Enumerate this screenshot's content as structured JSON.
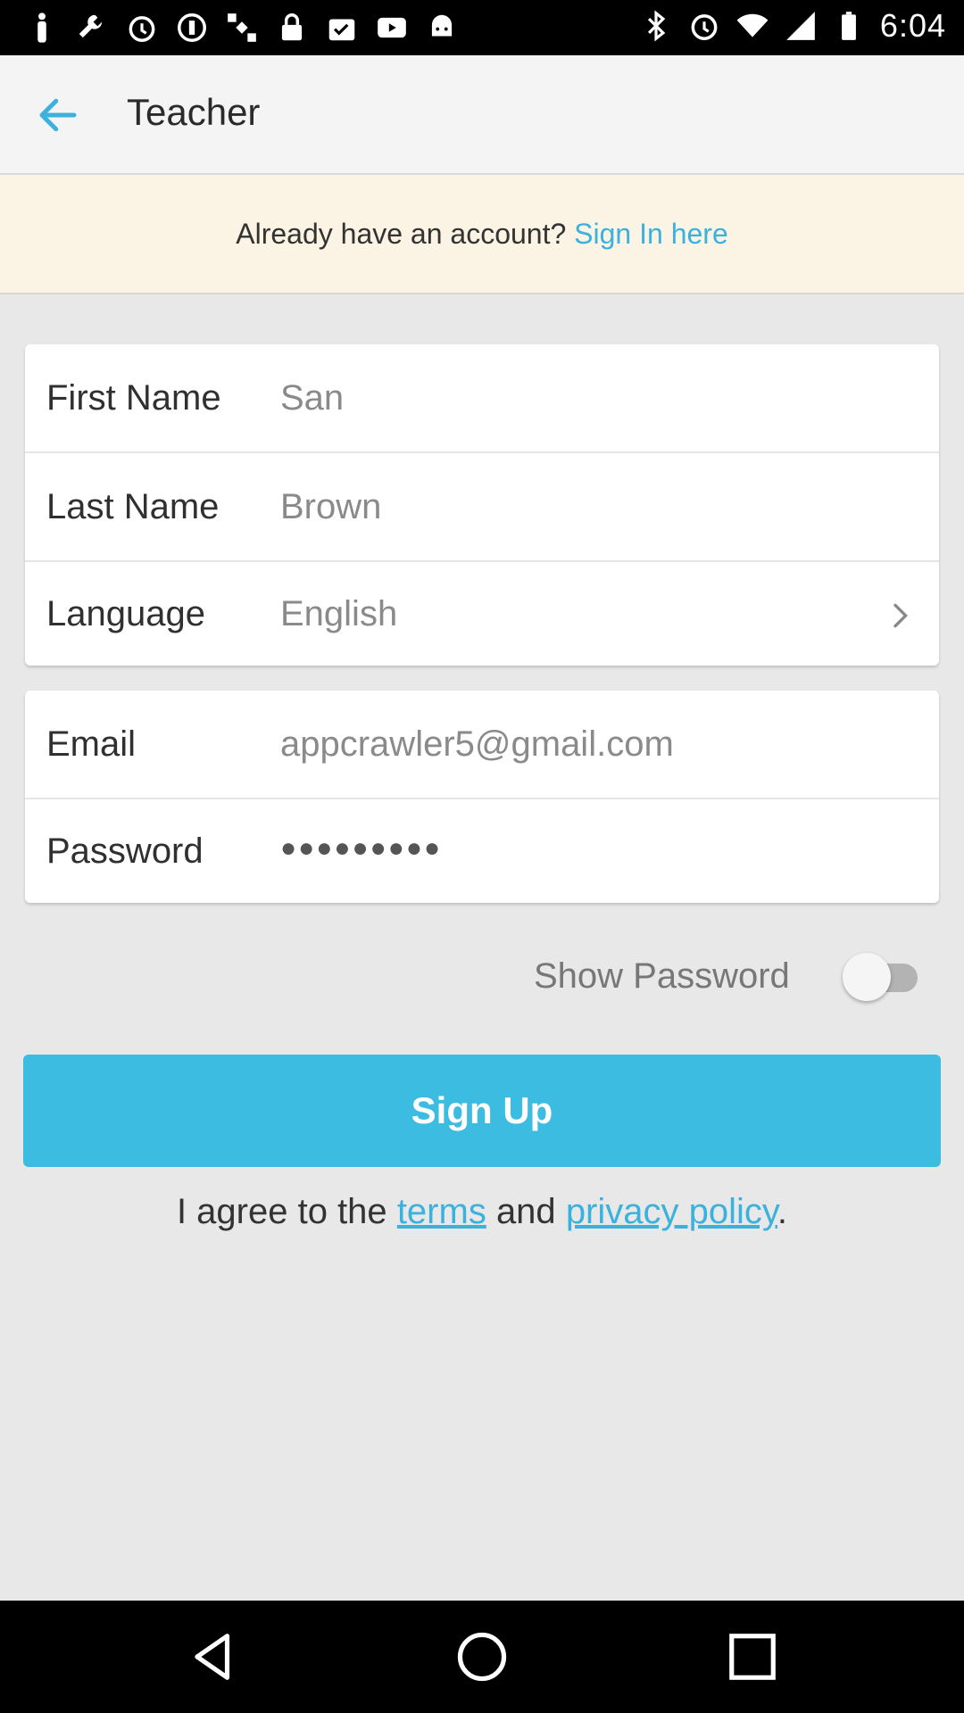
{
  "status_bar": {
    "time": "6:04",
    "left_icons": [
      "person-icon",
      "wrench-icon",
      "alarm-icon",
      "record-icon",
      "satellite-icon",
      "lock-icon",
      "clipboard-check-icon",
      "youtube-icon",
      "android-icon"
    ],
    "right_icons": [
      "bluetooth-icon",
      "alarm-icon",
      "wifi-icon",
      "signal-icon",
      "battery-icon"
    ]
  },
  "app_bar": {
    "title": "Teacher",
    "back_icon": "arrow-back-icon"
  },
  "banner": {
    "prompt": "Already have an account?",
    "link": "Sign In here"
  },
  "form": {
    "first_name": {
      "label": "First Name",
      "value": "San"
    },
    "last_name": {
      "label": "Last Name",
      "value": "Brown"
    },
    "language": {
      "label": "Language",
      "value": "English"
    },
    "email": {
      "label": "Email",
      "value": "appcrawler5@gmail.com"
    },
    "password": {
      "label": "Password",
      "value": "●●●●●●●●●"
    }
  },
  "show_password": {
    "label": "Show Password",
    "enabled": false
  },
  "signup_button": "Sign Up",
  "agree": {
    "prefix": "I agree to the",
    "terms": "terms",
    "and": "and",
    "privacy": "privacy policy",
    "suffix": "."
  },
  "colors": {
    "accent": "#3dbce2",
    "link": "#3bb1dd",
    "banner_bg": "#fbf3e4",
    "page_bg": "#e8e8e8"
  }
}
